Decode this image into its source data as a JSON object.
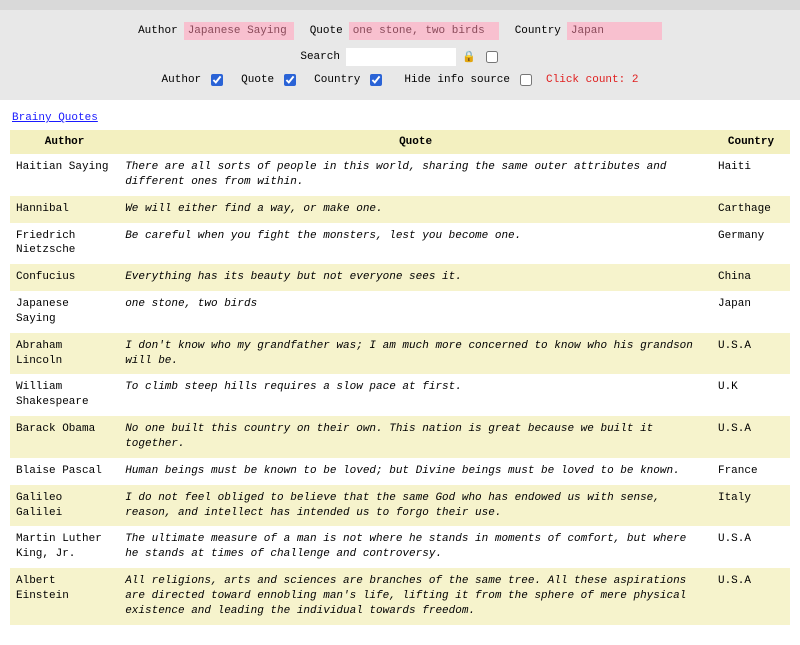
{
  "filters": {
    "author_label": "Author",
    "author_value": "Japanese Saying",
    "quote_label": "Quote",
    "quote_value": "one stone, two birds",
    "country_label": "Country",
    "country_value": "Japan"
  },
  "search": {
    "label": "Search",
    "value": "",
    "lock_icon": "🔒"
  },
  "toggles": {
    "author_label": "Author",
    "author_checked": true,
    "quote_label": "Quote",
    "quote_checked": true,
    "country_label": "Country",
    "country_checked": true,
    "hide_label": "Hide info source",
    "hide_checked": false,
    "click_count_label": "Click count: 2"
  },
  "link": {
    "brainy": "Brainy Quotes"
  },
  "table": {
    "headers": {
      "author": "Author",
      "quote": "Quote",
      "country": "Country"
    },
    "rows": [
      {
        "author": "Haitian Saying",
        "quote": "There are all sorts of people in this world, sharing the same outer attributes and different ones from within.",
        "country": "Haiti"
      },
      {
        "author": "Hannibal",
        "quote": "We will either find a way, or make one.",
        "country": "Carthage"
      },
      {
        "author": "Friedrich Nietzsche",
        "quote": "Be careful when you fight the monsters, lest you become one.",
        "country": "Germany"
      },
      {
        "author": "Confucius",
        "quote": "Everything has its beauty but not everyone sees it.",
        "country": "China"
      },
      {
        "author": "Japanese Saying",
        "quote": "one stone, two birds",
        "country": "Japan"
      },
      {
        "author": "Abraham Lincoln",
        "quote": "I don't know who my grandfather was; I am much more concerned to know who his grandson will be.",
        "country": "U.S.A"
      },
      {
        "author": "William Shakespeare",
        "quote": "To climb steep hills requires a slow pace at first.",
        "country": "U.K"
      },
      {
        "author": "Barack Obama",
        "quote": "No one built this country on their own. This nation is great because we built it together.",
        "country": "U.S.A"
      },
      {
        "author": "Blaise Pascal",
        "quote": "Human beings must be known to be loved; but Divine beings must be loved to be known.",
        "country": "France"
      },
      {
        "author": "Galileo Galilei",
        "quote": "I do not feel obliged to believe that the same God who has endowed us with sense, reason, and intellect has intended us to forgo their use.",
        "country": "Italy"
      },
      {
        "author": "Martin Luther King, Jr.",
        "quote": "The ultimate measure of a man is not where he stands in moments of comfort, but where he stands at times of challenge and controversy.",
        "country": "U.S.A"
      },
      {
        "author": "Albert Einstein",
        "quote": "All religions, arts and sciences are branches of the same tree. All these aspirations are directed toward ennobling man's life, lifting it from the sphere of mere physical existence and leading the individual towards freedom.",
        "country": "U.S.A"
      }
    ]
  }
}
